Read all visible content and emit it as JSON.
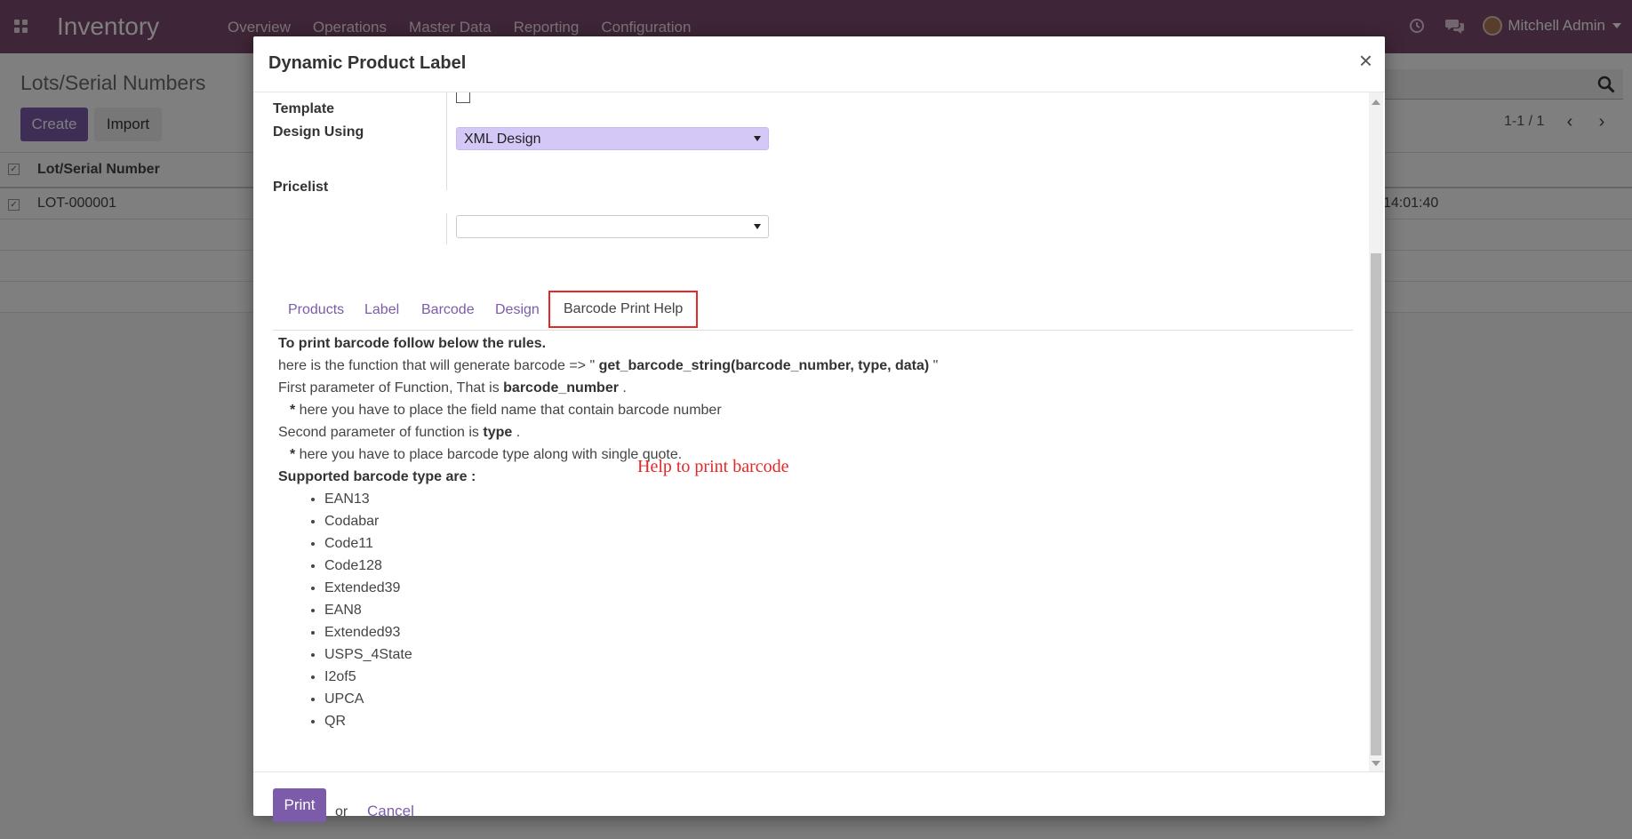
{
  "navbar": {
    "app_title": "Inventory",
    "menu": [
      "Overview",
      "Operations",
      "Master Data",
      "Reporting",
      "Configuration"
    ],
    "user_name": "Mitchell Admin"
  },
  "control_panel": {
    "title": "Lots/Serial Numbers",
    "create_label": "Create",
    "import_label": "Import",
    "pager": "1-1 / 1"
  },
  "list": {
    "column": "Lot/Serial Number",
    "rows": [
      {
        "lot": "LOT-000001",
        "date": "14:01:40"
      }
    ]
  },
  "modal": {
    "title": "Dynamic Product Label",
    "close": "×",
    "fields": {
      "template_label": "Template",
      "design_label": "Design Using",
      "design_value": "XML Design",
      "pricelist_label": "Pricelist",
      "pricelist_value": ""
    },
    "tabs": [
      "Products",
      "Label",
      "Barcode",
      "Design",
      "Barcode Print Help"
    ],
    "active_tab": "Barcode Print Help",
    "help": {
      "heading": "To print barcode follow below the rules.",
      "line1_prefix": "here is the function that will generate barcode => \" ",
      "line1_func": "get_barcode_string(barcode_number, type, data)",
      "line1_suffix": " \"",
      "line2_prefix": "First parameter of Function, That is ",
      "line2_bold": "barcode_number",
      "line2_suffix": " .",
      "line3_star": "*",
      "line3_text": " here you have to place the field name that contain barcode number",
      "line4_prefix": "Second parameter of function is ",
      "line4_bold": "type",
      "line4_suffix": " .",
      "line5_star": "*",
      "line5_text": " here you have to place barcode type along with single quote.",
      "supported_heading": "Supported barcode type are :",
      "types": [
        "EAN13",
        "Codabar",
        "Code11",
        "Code128",
        "Extended39",
        "EAN8",
        "Extended93",
        "USPS_4State",
        "I2of5",
        "UPCA",
        "QR"
      ]
    },
    "annotation": "Help to print barcode",
    "footer": {
      "print_label": "Print",
      "or_text": "or",
      "cancel_label": "Cancel"
    }
  },
  "colors": {
    "navbar": "#7c4a6e",
    "primary": "#7c5bab",
    "annotation": "#e52727",
    "design_select": "#d4c8f7"
  }
}
